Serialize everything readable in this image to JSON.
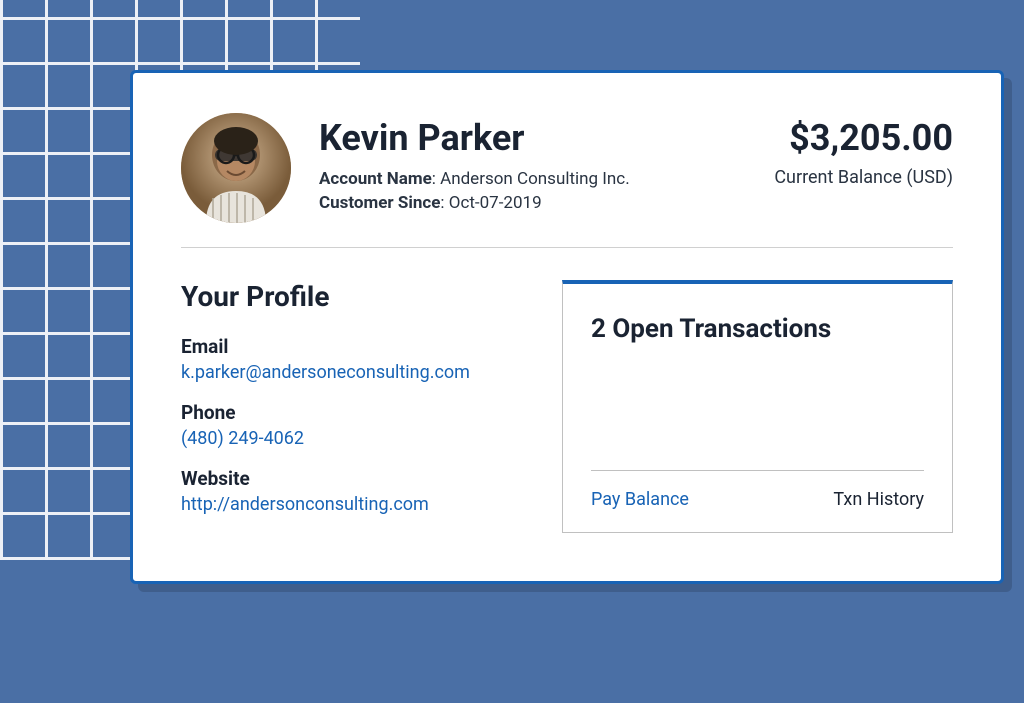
{
  "customer": {
    "name": "Kevin Parker",
    "account_name_label": "Account Name",
    "account_name": "Anderson Consulting Inc.",
    "since_label": "Customer Since",
    "since": "Oct-07-2019"
  },
  "balance": {
    "amount": "$3,205.00",
    "label": "Current Balance (USD)"
  },
  "profile": {
    "title": "Your Profile",
    "email_label": "Email",
    "email": "k.parker@andersoneconsulting.com",
    "phone_label": "Phone",
    "phone": "(480) 249-4062",
    "website_label": "Website",
    "website": "http://andersonconsulting.com"
  },
  "transactions": {
    "title": "2 Open Transactions",
    "pay_balance": "Pay Balance",
    "history": "Txn History"
  }
}
